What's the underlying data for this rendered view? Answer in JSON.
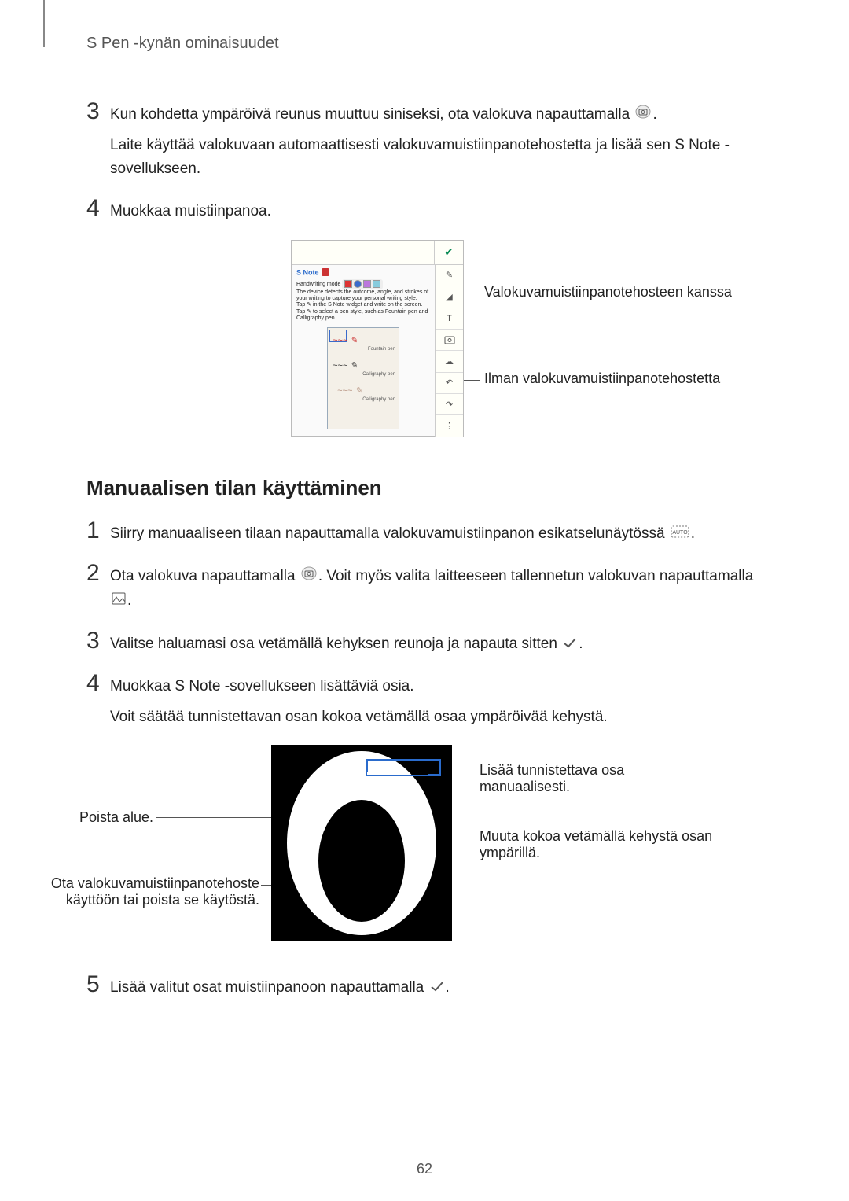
{
  "header": "S Pen -kynän ominaisuudet",
  "page_number": "62",
  "steps_a": {
    "s3": {
      "num": "3",
      "p1a": "Kun kohdetta ympäröivä reunus muuttuu siniseksi, ota valokuva napauttamalla ",
      "p1b": ".",
      "p2": "Laite käyttää valokuvaan automaattisesti valokuvamuistiinpanotehostetta ja lisää sen S Note -sovellukseen."
    },
    "s4": {
      "num": "4",
      "p1": "Muokkaa muistiinpanoa."
    }
  },
  "fig1": {
    "snote": "S Note",
    "hand": "Handwriting mode",
    "desc1": "The device detects the outcome, angle, and strokes of your writing to capture your personal writing style.",
    "desc2": "Tap ✎ in the S Note widget and write on the screen.",
    "desc3": "Tap ✎ to select a pen style, such as Fountain pen and Calligraphy pen.",
    "thumb_tag1": "Fountain pen",
    "thumb_tag2": "Calligraphy pen",
    "thumb_tag3": "Calligraphy pen",
    "side_t": "T",
    "label_r1": "Valokuvamuistiinpanotehosteen kanssa",
    "label_r2": "Ilman valokuvamuistiinpanotehostetta"
  },
  "h2": "Manuaalisen tilan käyttäminen",
  "steps_b": {
    "s1": {
      "num": "1",
      "p1a": "Siirry manuaaliseen tilaan napauttamalla valokuvamuistiinpanon esikatselunäytössä ",
      "p1b": "."
    },
    "s2": {
      "num": "2",
      "p1a": "Ota valokuva napauttamalla ",
      "p1b": ". Voit myös valita laitteeseen tallennetun valokuvan napauttamalla ",
      "p1c": "."
    },
    "s3": {
      "num": "3",
      "p1a": "Valitse haluamasi osa vetämällä kehyksen reunoja ja napauta sitten ",
      "p1b": "."
    },
    "s4": {
      "num": "4",
      "p1": "Muokkaa S Note -sovellukseen lisättäviä osia.",
      "p2": "Voit säätää tunnistettavan osan kokoa vetämällä osaa ympäröivää kehystä."
    },
    "s5": {
      "num": "5",
      "p1a": "Lisää valitut osat muistiinpanoon napauttamalla ",
      "p1b": "."
    }
  },
  "fig2": {
    "label_r1": "Lisää tunnistettava osa manuaalisesti.",
    "label_r2": "Muuta kokoa vetämällä kehystä osan ympärillä.",
    "label_l1": "Poista alue.",
    "label_l2": "Ota valokuvamuistiinpanotehoste käyttöön tai poista se käytöstä."
  }
}
